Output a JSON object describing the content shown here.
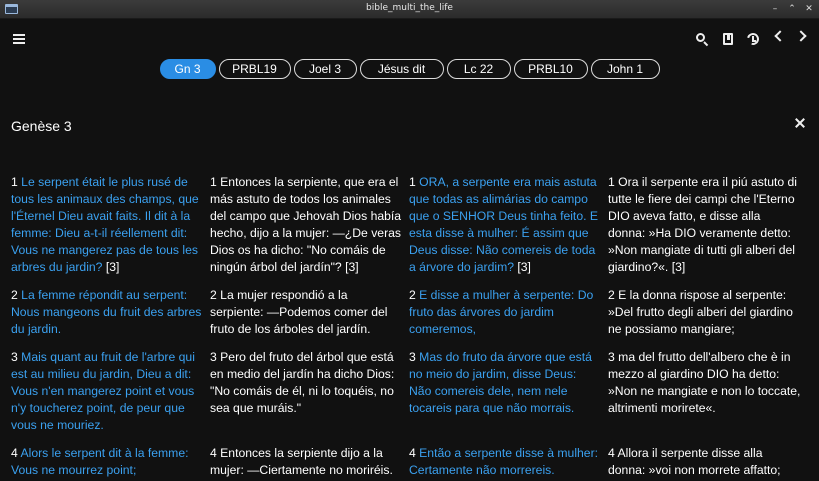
{
  "window": {
    "title": "bible_multi_the_life",
    "controls": [
      "–",
      "⌃",
      "✕"
    ]
  },
  "toolbar": {
    "icons": [
      "menu-icon",
      "search-icon",
      "bookmark-icon",
      "history-icon",
      "chevron-left-icon",
      "chevron-right-icon"
    ]
  },
  "tabs": [
    {
      "label": "Gn 3",
      "active": true
    },
    {
      "label": "PRBL19",
      "active": false
    },
    {
      "label": "Joel 3",
      "active": false
    },
    {
      "label": "Jésus dit",
      "active": false
    },
    {
      "label": "Lc 22",
      "active": false
    },
    {
      "label": "PRBL10",
      "active": false
    },
    {
      "label": "John 1",
      "active": false
    }
  ],
  "book_title": "Genèse 3",
  "colors": {
    "accent": "#2a8de4",
    "link_text": "#3ba1f0",
    "background": "#111111"
  },
  "verses": [
    [
      {
        "num": "1",
        "text": "Le serpent était le plus rusé de tous les animaux des champs, que l'Éternel Dieu avait faits. Il dit à la femme: Dieu a-t-il réellement dit: Vous ne mangerez pas de tous les arbres du jardin?",
        "ref": "[3]",
        "color": "blue"
      },
      {
        "num": "1",
        "text": "Entonces la serpiente, que era el más astuto de todos los animales del campo que Jehovah Dios había hecho, dijo a la mujer: —¿De veras Dios os ha dicho: \"No comáis de ningún árbol del jardín\"?",
        "ref": "[3]",
        "color": "white"
      },
      {
        "num": "1",
        "text": "ORA, a serpente era mais astuta que todas as alimárias do campo que o SENHOR Deus tinha feito. E esta disse à mulher: É assim que Deus disse: Não comereis de toda a árvore do jardim?",
        "ref": "[3]",
        "color": "blue"
      },
      {
        "num": "1",
        "text": "Ora il serpente era il piú astuto di tutte le fiere dei campi che l'Eterno DIO aveva fatto, e disse alla donna: »Ha DIO veramente detto: »Non mangiate di tutti gli alberi del giardino?«.",
        "ref": "[3]",
        "color": "white"
      }
    ],
    [
      {
        "num": "2",
        "text": "La femme répondit au serpent: Nous mangeons du fruit des arbres du jardin.",
        "ref": "",
        "color": "blue"
      },
      {
        "num": "2",
        "text": "La mujer respondió a la serpiente: —Podemos comer del fruto de los árboles del jardín.",
        "ref": "",
        "color": "white"
      },
      {
        "num": "2",
        "text": "E disse a mulher à serpente: Do fruto das árvores do jardim comeremos,",
        "ref": "",
        "color": "blue"
      },
      {
        "num": "2",
        "text": "E la donna rispose al serpente: »Del frutto degli alberi del giardino ne possiamo mangiare;",
        "ref": "",
        "color": "white"
      }
    ],
    [
      {
        "num": "3",
        "text": "Mais quant au fruit de l'arbre qui est au milieu du jardin, Dieu a dit: Vous n'en mangerez point et vous n'y toucherez point, de peur que vous ne mouriez.",
        "ref": "",
        "color": "blue"
      },
      {
        "num": "3",
        "text": "Pero del fruto del árbol que está en medio del jardín ha dicho Dios: \"No comáis de él, ni lo toquéis, no sea que muráis.\"",
        "ref": "",
        "color": "white"
      },
      {
        "num": "3",
        "text": "Mas do fruto da árvore que está no meio do jardim, disse Deus: Não comereis dele, nem nele tocareis para que não morrais.",
        "ref": "",
        "color": "blue"
      },
      {
        "num": "3",
        "text": "ma del frutto dell'albero che è in mezzo al giardino DIO ha detto: »Non ne mangiate e non lo toccate, altrimenti morirete«.",
        "ref": "",
        "color": "white"
      }
    ],
    [
      {
        "num": "4",
        "text": "Alors le serpent dit à la femme: Vous ne mourrez point;",
        "ref": "",
        "color": "blue"
      },
      {
        "num": "4",
        "text": "Entonces la serpiente dijo a la mujer: —Ciertamente no moriréis.",
        "ref": "",
        "color": "white"
      },
      {
        "num": "4",
        "text": "Então a serpente disse à mulher: Certamente não morrereis.",
        "ref": "",
        "color": "blue"
      },
      {
        "num": "4",
        "text": "Allora il serpente disse alla donna: »voi non morrete affatto;",
        "ref": "",
        "color": "white"
      }
    ]
  ]
}
